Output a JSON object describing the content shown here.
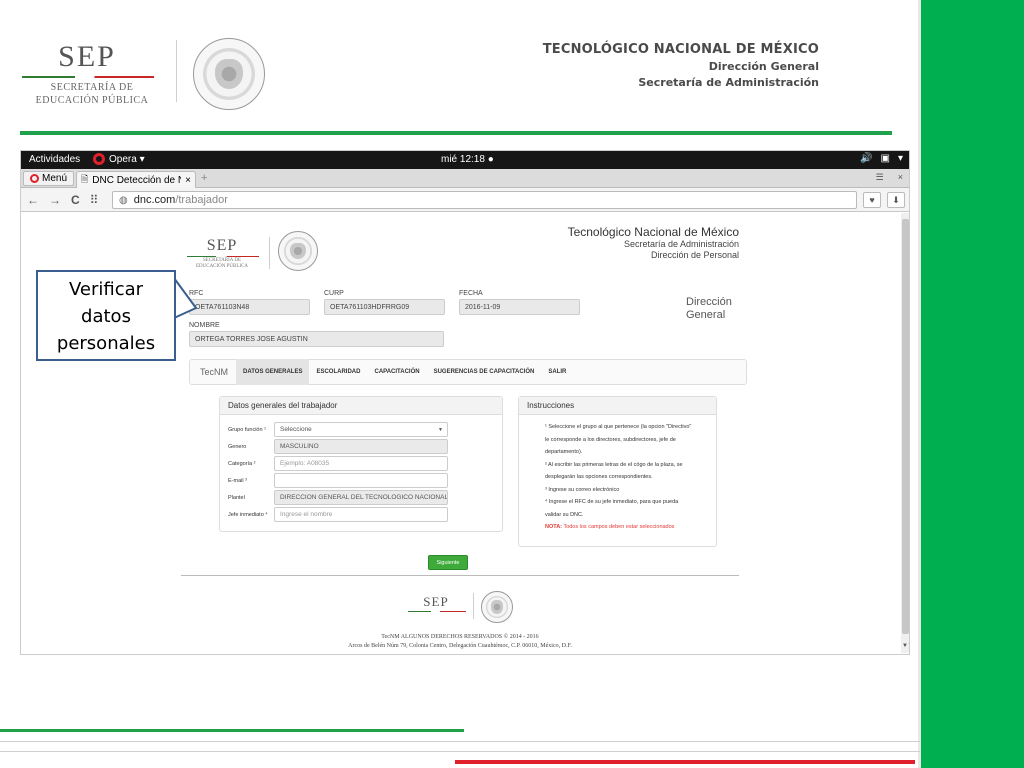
{
  "slide": {
    "logo_sep": "SEP",
    "logo_sub1": "SECRETARÍA DE",
    "logo_sub2": "EDUCACIÓN PÚBLICA",
    "header_line1": "TECNOLÓGICO NACIONAL DE MÉXICO",
    "header_line2": "Dirección General",
    "header_line3": "Secretaría de Administración",
    "callout_line1": "Verificar",
    "callout_line2": "datos",
    "callout_line3": "personales",
    "colors": {
      "green": "#00b050",
      "red": "#e0202a",
      "callout_border": "#3a5f8f"
    }
  },
  "desktop": {
    "activities": "Actividades",
    "app": "Opera ▾",
    "clock": "mié 12:18 ●",
    "tray": [
      "🔊",
      "▣",
      "▾"
    ]
  },
  "browser": {
    "menu_label": "Menú",
    "tab_title": "DNC Detección de Ne",
    "tab_close": "×",
    "new_tab": "+",
    "url_domain": "dnc.com",
    "url_path": "/trabajador",
    "nav_icons": [
      "←",
      "→",
      "C",
      "⠿"
    ],
    "right_icons": [
      "♥",
      "⬇"
    ]
  },
  "page": {
    "sep": "SEP",
    "sep_sub1": "SECRETARÍA DE",
    "sep_sub2": "EDUCACIÓN PÚBLICA",
    "title1": "Tecnológico Nacional de México",
    "title2": "Secretaría de Administración",
    "title3": "Dirección de Personal",
    "rfc_label": "RFC",
    "rfc_value": "OETA761103N48",
    "curp_label": "CURP",
    "curp_value": "OETA761103HDFRRG09",
    "fecha_label": "FECHA",
    "fecha_value": "2016-11-09",
    "nombre_label": "NOMBRE",
    "nombre_value": "ORTEGA TORRES JOSE AGUSTIN",
    "dir_gen_1": "Dirección",
    "dir_gen_2": "General",
    "nav": {
      "brand": "TecNM",
      "items": [
        "DATOS GENERALES",
        "ESCOLARIDAD",
        "CAPACITACIÓN",
        "SUGERENCIAS DE CAPACITACIÓN",
        "SALIR"
      ],
      "active_index": 0
    },
    "form": {
      "heading": "Datos generales del trabajador",
      "fields": [
        {
          "label": "Grupo función ¹",
          "value": "Seleccione",
          "kind": "select"
        },
        {
          "label": "Genero",
          "value": "MASCULINO",
          "kind": "readonly"
        },
        {
          "label": "Categoría ²",
          "placeholder": "Ejemplo: A08035",
          "kind": "input"
        },
        {
          "label": "E-mail ³",
          "value": "",
          "kind": "input"
        },
        {
          "label": "Plantel",
          "value": "DIRECCION GENERAL DEL TECNOLOGICO NACIONAL",
          "kind": "readonly"
        },
        {
          "label": "Jefe inmediato ⁴",
          "placeholder": "Ingrese el nombre",
          "kind": "input"
        }
      ]
    },
    "instructions": {
      "heading": "Instrucciones",
      "lines": [
        "¹ Seleccione el grupo al que pertenece (la opcion \"Directivo\"",
        "le corresponde a los directores, subdirectores, jefe de",
        "departamento).",
        "² Al escribir las primeras letras de el cógo de la plaza, se",
        "desplegarán las opciones correspondientes.",
        "³ Ingrese su correo electrónico",
        "⁴ Ingrese el RFC de su jefe inmediato, para que pueda",
        "validar su DNC."
      ],
      "note_label": "NOTA:",
      "note_text": " Todos los campos deben estar seleccionados"
    },
    "next_button": "Siguiente",
    "footer_sep": "SEP",
    "footer_line1": "TecNM ALGUNOS DERECHOS RESERVADOS © 2014 - 2016",
    "footer_line2": "Arcos de Belén Núm 79, Colonia Centro, Delegación Cuauhtémoc, C.P. 06010, México, D.F."
  }
}
